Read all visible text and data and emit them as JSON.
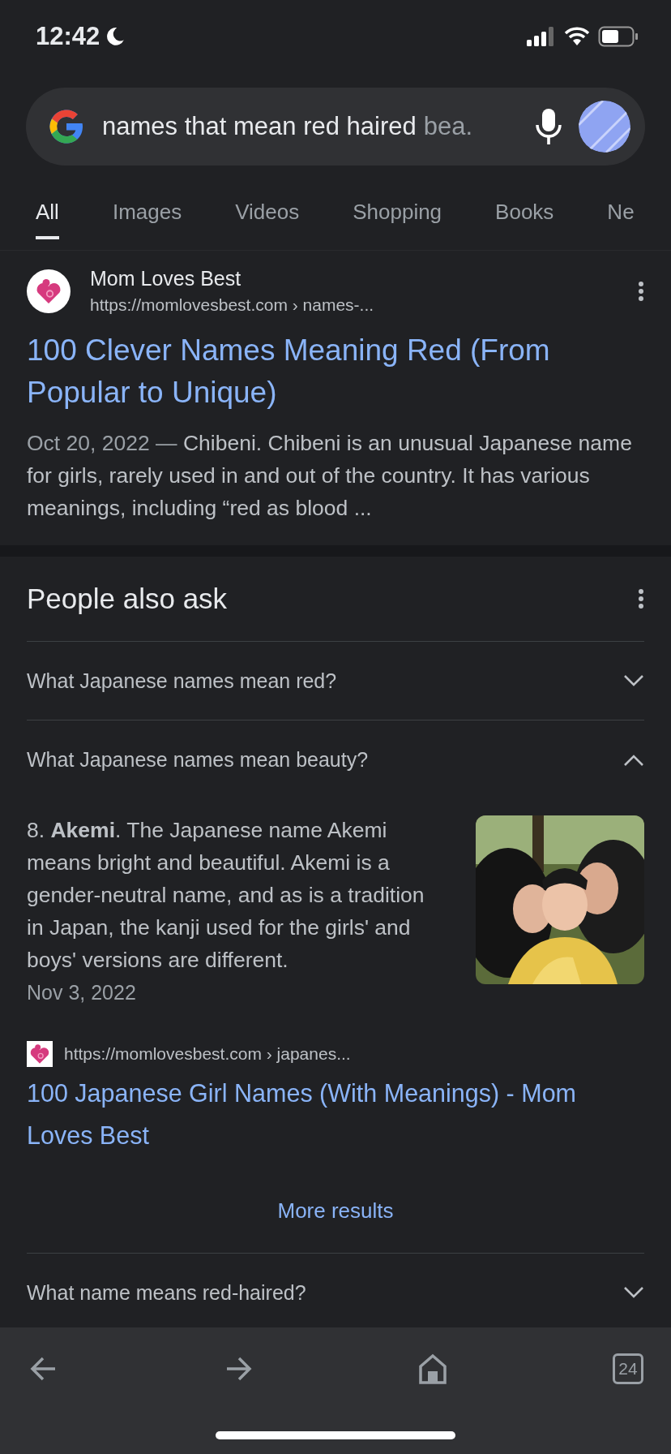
{
  "status_bar": {
    "time": "12:42"
  },
  "search": {
    "query": "names that mean red haired",
    "query_faded": "bea."
  },
  "tabs": [
    {
      "label": "All",
      "selected": true
    },
    {
      "label": "Images",
      "selected": false
    },
    {
      "label": "Videos",
      "selected": false
    },
    {
      "label": "Shopping",
      "selected": false
    },
    {
      "label": "Books",
      "selected": false
    },
    {
      "label": "Ne",
      "selected": false
    }
  ],
  "result": {
    "site": "Mom Loves Best",
    "url": "https://momlovesbest.com › names-...",
    "title": "100 Clever Names Meaning Red (From Popular to Unique)",
    "date": "Oct 20, 2022 —",
    "snippet": "Chibeni. Chibeni is an unusual Japanese name for girls, rarely used in and out of the country. It has various meanings, including “red as blood ..."
  },
  "people_also_ask": {
    "title": "People also ask",
    "questions": [
      {
        "text": "What Japanese names mean red?",
        "expanded": false
      },
      {
        "text": "What Japanese names mean beauty?",
        "expanded": true,
        "answer": {
          "text": "8. **Akemi**. The Japanese name Akemi means bright and beautiful. Akemi is a gender-neutral name, and as is a tradition in Japan, the kanji used for the girls' and boys' versions are different.",
          "date": "Nov 3, 2022",
          "url": "https://momlovesbest.com › japanes...",
          "title": "100 Japanese Girl Names (With Meanings) - Mom Loves Best"
        }
      },
      {
        "text": "What name means red-haired?",
        "expanded": false
      }
    ],
    "more": "More results"
  },
  "toolbar": {
    "tab_count": "24"
  }
}
